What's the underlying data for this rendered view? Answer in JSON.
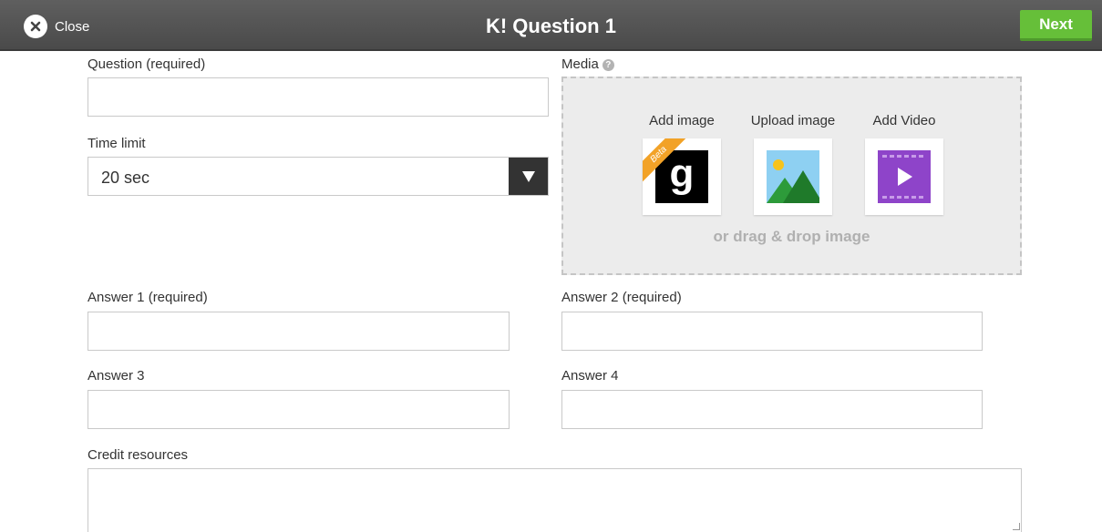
{
  "header": {
    "close_label": "Close",
    "logo": "K!",
    "title": "Question 1",
    "next_label": "Next"
  },
  "question": {
    "label": "Question (required)",
    "value": ""
  },
  "time_limit": {
    "label": "Time limit",
    "selected": "20 sec"
  },
  "media": {
    "label": "Media",
    "help_icon": "?",
    "options": [
      {
        "label": "Add image",
        "icon": "getty-g-icon",
        "badge": "Beta",
        "glyph": "g"
      },
      {
        "label": "Upload image",
        "icon": "landscape-image-icon"
      },
      {
        "label": "Add Video",
        "icon": "video-play-icon"
      }
    ],
    "drop_text": "or drag & drop image"
  },
  "answers": [
    {
      "label": "Answer 1 (required)",
      "value": ""
    },
    {
      "label": "Answer 2 (required)",
      "value": ""
    },
    {
      "label": "Answer 3",
      "value": ""
    },
    {
      "label": "Answer 4",
      "value": ""
    }
  ],
  "credit": {
    "label": "Credit resources",
    "value": ""
  },
  "colors": {
    "topbar": "#555555",
    "next_button": "#66bf39",
    "beta_badge": "#f2a227",
    "video_tile": "#8e44c9"
  }
}
